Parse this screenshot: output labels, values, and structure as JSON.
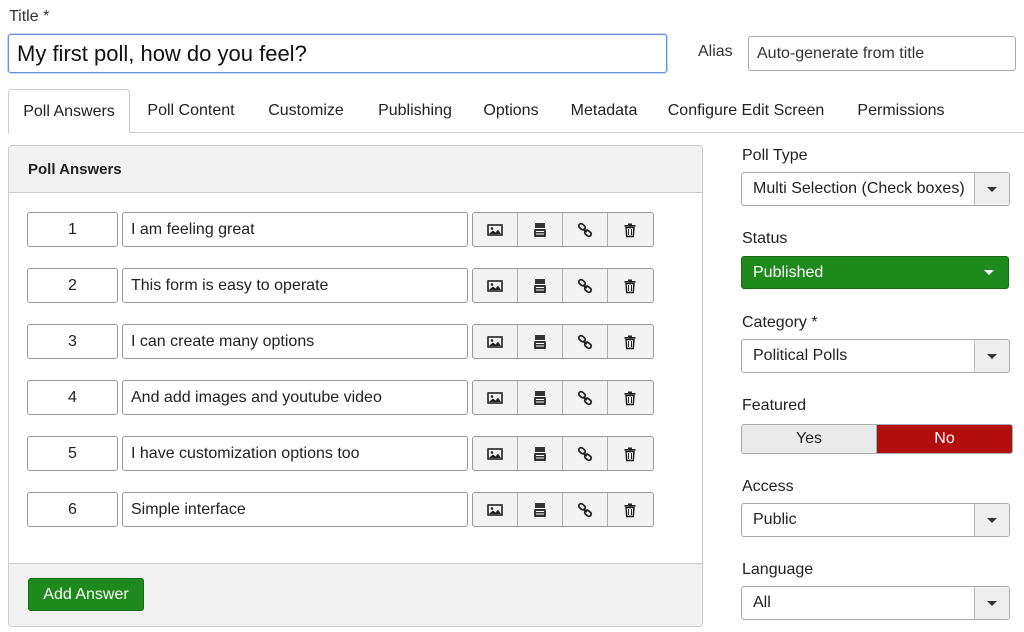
{
  "title": {
    "label": "Title *",
    "value": "My first poll, how do you feel?"
  },
  "alias": {
    "label": "Alias",
    "placeholder": "Auto-generate from title"
  },
  "tabs": [
    {
      "label": "Poll Answers",
      "active": true
    },
    {
      "label": "Poll Content"
    },
    {
      "label": "Customize"
    },
    {
      "label": "Publishing"
    },
    {
      "label": "Options"
    },
    {
      "label": "Metadata"
    },
    {
      "label": "Configure Edit Screen"
    },
    {
      "label": "Permissions"
    }
  ],
  "answers_panel": {
    "header": "Poll Answers",
    "rows": [
      {
        "num": "1",
        "text": "I am feeling great"
      },
      {
        "num": "2",
        "text": "This form is easy to operate"
      },
      {
        "num": "3",
        "text": "I can create many options"
      },
      {
        "num": "4",
        "text": "And add images and youtube video"
      },
      {
        "num": "5",
        "text": "I have customization options too"
      },
      {
        "num": "6",
        "text": "Simple interface"
      }
    ],
    "row_icons": [
      "image-icon",
      "youtube-icon",
      "link-icon",
      "trash-icon"
    ],
    "add_button": "Add Answer"
  },
  "sidebar": {
    "poll_type": {
      "label": "Poll Type",
      "value": "Multi Selection (Check boxes)"
    },
    "status": {
      "label": "Status",
      "value": "Published"
    },
    "category": {
      "label": "Category *",
      "value": "Political Polls"
    },
    "featured": {
      "label": "Featured",
      "yes": "Yes",
      "no": "No",
      "selected": "No"
    },
    "access": {
      "label": "Access",
      "value": "Public"
    },
    "language": {
      "label": "Language",
      "value": "All"
    }
  },
  "colors": {
    "green": "#1e8a1e",
    "red": "#b30d0d",
    "focus_border": "#6b8fd8"
  }
}
